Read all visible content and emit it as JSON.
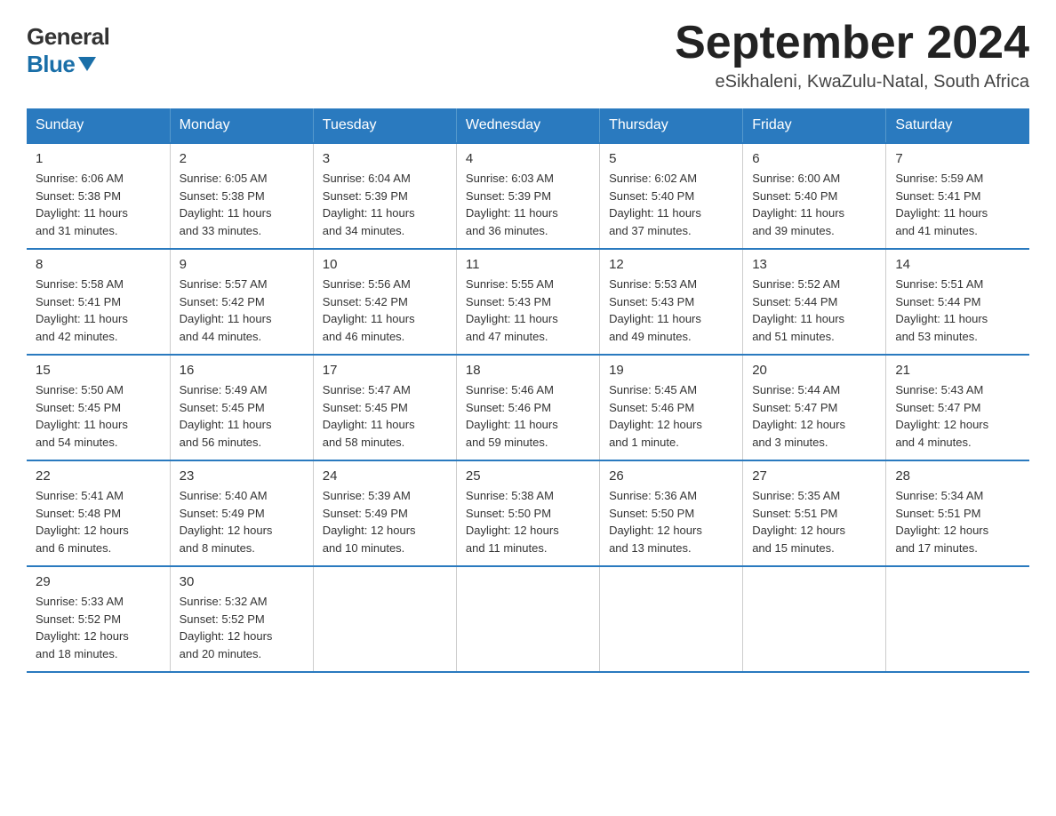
{
  "logo": {
    "general": "General",
    "blue": "Blue"
  },
  "header": {
    "month": "September 2024",
    "location": "eSikhaleni, KwaZulu-Natal, South Africa"
  },
  "days_of_week": [
    "Sunday",
    "Monday",
    "Tuesday",
    "Wednesday",
    "Thursday",
    "Friday",
    "Saturday"
  ],
  "weeks": [
    [
      {
        "day": "1",
        "info": "Sunrise: 6:06 AM\nSunset: 5:38 PM\nDaylight: 11 hours\nand 31 minutes."
      },
      {
        "day": "2",
        "info": "Sunrise: 6:05 AM\nSunset: 5:38 PM\nDaylight: 11 hours\nand 33 minutes."
      },
      {
        "day": "3",
        "info": "Sunrise: 6:04 AM\nSunset: 5:39 PM\nDaylight: 11 hours\nand 34 minutes."
      },
      {
        "day": "4",
        "info": "Sunrise: 6:03 AM\nSunset: 5:39 PM\nDaylight: 11 hours\nand 36 minutes."
      },
      {
        "day": "5",
        "info": "Sunrise: 6:02 AM\nSunset: 5:40 PM\nDaylight: 11 hours\nand 37 minutes."
      },
      {
        "day": "6",
        "info": "Sunrise: 6:00 AM\nSunset: 5:40 PM\nDaylight: 11 hours\nand 39 minutes."
      },
      {
        "day": "7",
        "info": "Sunrise: 5:59 AM\nSunset: 5:41 PM\nDaylight: 11 hours\nand 41 minutes."
      }
    ],
    [
      {
        "day": "8",
        "info": "Sunrise: 5:58 AM\nSunset: 5:41 PM\nDaylight: 11 hours\nand 42 minutes."
      },
      {
        "day": "9",
        "info": "Sunrise: 5:57 AM\nSunset: 5:42 PM\nDaylight: 11 hours\nand 44 minutes."
      },
      {
        "day": "10",
        "info": "Sunrise: 5:56 AM\nSunset: 5:42 PM\nDaylight: 11 hours\nand 46 minutes."
      },
      {
        "day": "11",
        "info": "Sunrise: 5:55 AM\nSunset: 5:43 PM\nDaylight: 11 hours\nand 47 minutes."
      },
      {
        "day": "12",
        "info": "Sunrise: 5:53 AM\nSunset: 5:43 PM\nDaylight: 11 hours\nand 49 minutes."
      },
      {
        "day": "13",
        "info": "Sunrise: 5:52 AM\nSunset: 5:44 PM\nDaylight: 11 hours\nand 51 minutes."
      },
      {
        "day": "14",
        "info": "Sunrise: 5:51 AM\nSunset: 5:44 PM\nDaylight: 11 hours\nand 53 minutes."
      }
    ],
    [
      {
        "day": "15",
        "info": "Sunrise: 5:50 AM\nSunset: 5:45 PM\nDaylight: 11 hours\nand 54 minutes."
      },
      {
        "day": "16",
        "info": "Sunrise: 5:49 AM\nSunset: 5:45 PM\nDaylight: 11 hours\nand 56 minutes."
      },
      {
        "day": "17",
        "info": "Sunrise: 5:47 AM\nSunset: 5:45 PM\nDaylight: 11 hours\nand 58 minutes."
      },
      {
        "day": "18",
        "info": "Sunrise: 5:46 AM\nSunset: 5:46 PM\nDaylight: 11 hours\nand 59 minutes."
      },
      {
        "day": "19",
        "info": "Sunrise: 5:45 AM\nSunset: 5:46 PM\nDaylight: 12 hours\nand 1 minute."
      },
      {
        "day": "20",
        "info": "Sunrise: 5:44 AM\nSunset: 5:47 PM\nDaylight: 12 hours\nand 3 minutes."
      },
      {
        "day": "21",
        "info": "Sunrise: 5:43 AM\nSunset: 5:47 PM\nDaylight: 12 hours\nand 4 minutes."
      }
    ],
    [
      {
        "day": "22",
        "info": "Sunrise: 5:41 AM\nSunset: 5:48 PM\nDaylight: 12 hours\nand 6 minutes."
      },
      {
        "day": "23",
        "info": "Sunrise: 5:40 AM\nSunset: 5:49 PM\nDaylight: 12 hours\nand 8 minutes."
      },
      {
        "day": "24",
        "info": "Sunrise: 5:39 AM\nSunset: 5:49 PM\nDaylight: 12 hours\nand 10 minutes."
      },
      {
        "day": "25",
        "info": "Sunrise: 5:38 AM\nSunset: 5:50 PM\nDaylight: 12 hours\nand 11 minutes."
      },
      {
        "day": "26",
        "info": "Sunrise: 5:36 AM\nSunset: 5:50 PM\nDaylight: 12 hours\nand 13 minutes."
      },
      {
        "day": "27",
        "info": "Sunrise: 5:35 AM\nSunset: 5:51 PM\nDaylight: 12 hours\nand 15 minutes."
      },
      {
        "day": "28",
        "info": "Sunrise: 5:34 AM\nSunset: 5:51 PM\nDaylight: 12 hours\nand 17 minutes."
      }
    ],
    [
      {
        "day": "29",
        "info": "Sunrise: 5:33 AM\nSunset: 5:52 PM\nDaylight: 12 hours\nand 18 minutes."
      },
      {
        "day": "30",
        "info": "Sunrise: 5:32 AM\nSunset: 5:52 PM\nDaylight: 12 hours\nand 20 minutes."
      },
      {
        "day": "",
        "info": ""
      },
      {
        "day": "",
        "info": ""
      },
      {
        "day": "",
        "info": ""
      },
      {
        "day": "",
        "info": ""
      },
      {
        "day": "",
        "info": ""
      }
    ]
  ]
}
